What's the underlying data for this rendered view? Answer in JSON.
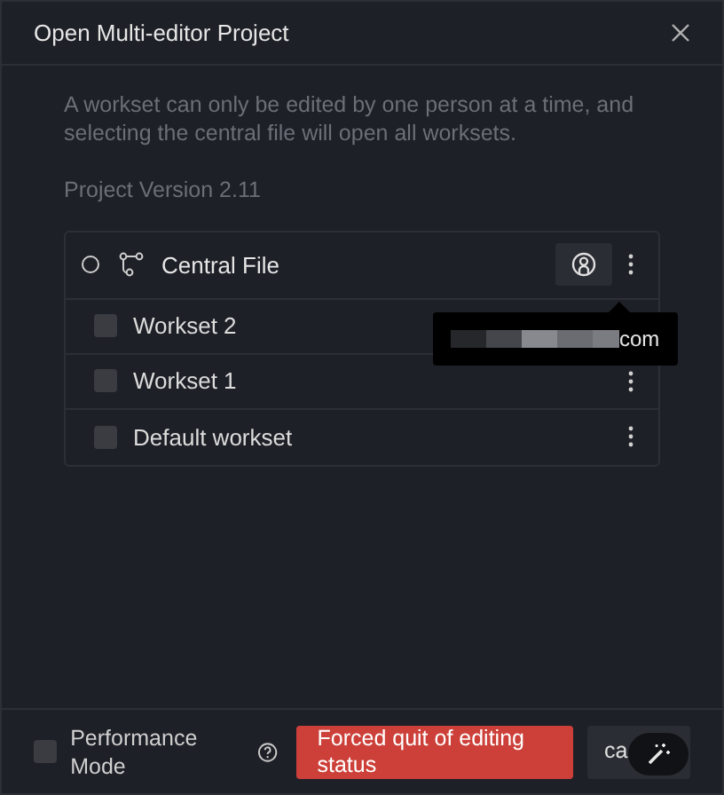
{
  "window": {
    "title": "Open Multi-editor Project"
  },
  "description": "A workset can only be edited by one person at a time, and selecting the central file will open all worksets.",
  "project_version": "Project Version 2.11",
  "central_file": {
    "label": "Central File",
    "selected": false
  },
  "tooltip": {
    "text": "com"
  },
  "worksets": [
    {
      "label": "Workset 2",
      "checked": false,
      "menu": false
    },
    {
      "label": "Workset 1",
      "checked": false,
      "menu": true
    },
    {
      "label": "Default workset",
      "checked": false,
      "menu": true
    }
  ],
  "footer": {
    "performance_mode": {
      "label": "Performance Mode",
      "checked": false
    },
    "force_quit_button": "Forced quit of editing status",
    "cancel_button": "ca"
  }
}
